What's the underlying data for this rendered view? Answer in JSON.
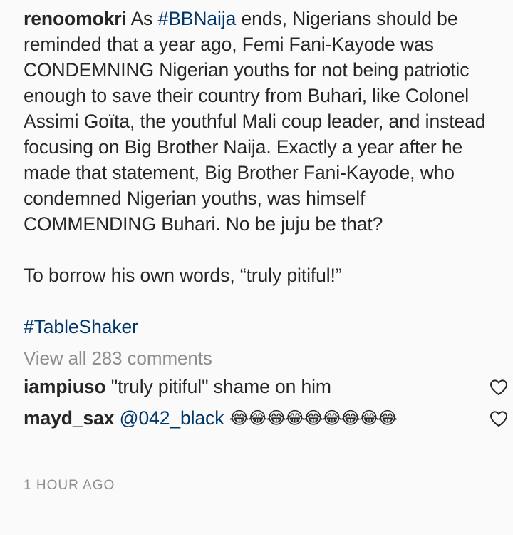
{
  "post": {
    "username": "renoomokri",
    "caption_lead": "As ",
    "caption_hashtag": "#BBNaija",
    "caption_rest": " ends, Nigerians should be reminded that a year ago, Femi Fani-Kayode was CONDEMNING Nigerian youths for not being patriotic enough to save their country from Buhari, like Colonel Assimi Goïta, the youthful Mali coup leader, and instead focusing on Big Brother Naija. Exactly a year after he made that statement, Big Brother Fani-Kayode, who condemned Nigerian youths, was himself COMMENDING Buhari. No be juju be that?",
    "paragraph_2": "To borrow his own words, “truly pitiful!”",
    "footer_hashtag": "#TableShaker",
    "view_all_comments": "View all 283 comments",
    "timestamp": "1 HOUR AGO"
  },
  "comments": [
    {
      "username": "iampiuso",
      "text": "\"truly pitiful\" shame on him",
      "like_icon": "heart-outline-icon"
    },
    {
      "username": "mayd_sax",
      "mention": "@042_black",
      "emojis": "😂😂😂😂😂😂😂😂😂",
      "like_icon": "heart-outline-icon"
    }
  ],
  "colors": {
    "text": "#262626",
    "link": "#00376b",
    "muted": "#8e8e8e",
    "background": "#fafafa"
  }
}
